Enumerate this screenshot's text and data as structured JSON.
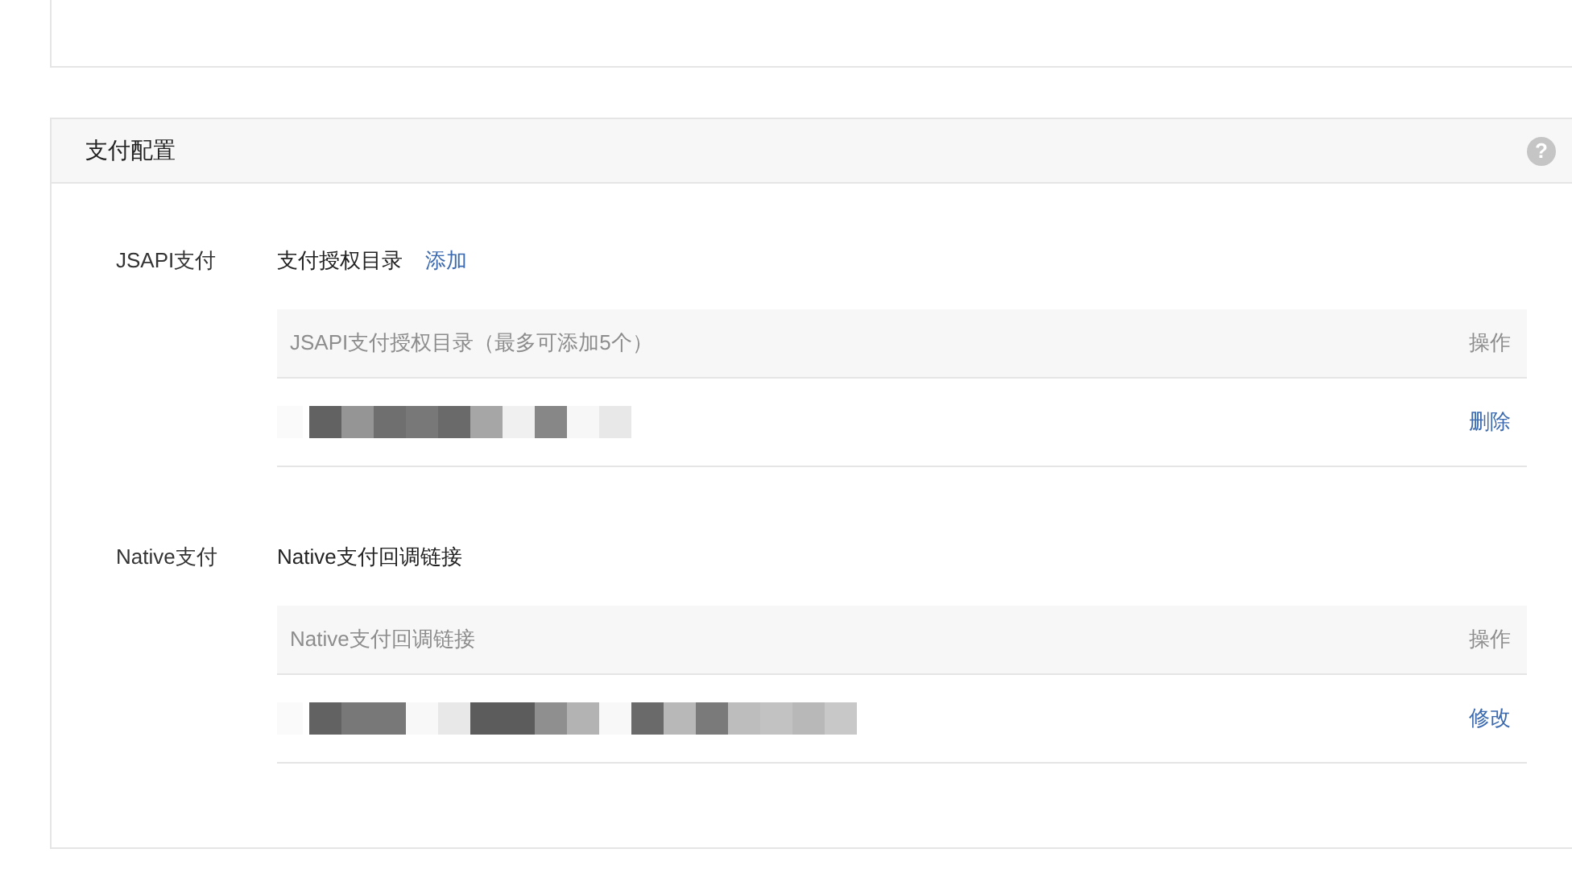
{
  "section": {
    "title": "支付配置",
    "help": "?"
  },
  "rows": [
    {
      "label": "JSAPI支付",
      "subtitle": "支付授权目录",
      "action": "添加",
      "table": {
        "columns": [
          "JSAPI支付授权目录（最多可添加5个）",
          "操作"
        ],
        "rows": [
          {
            "op": "删除",
            "kind": "short"
          }
        ]
      }
    },
    {
      "label": "Native支付",
      "subtitle": "Native支付回调链接",
      "table": {
        "columns": [
          "Native支付回调链接",
          "操作"
        ],
        "rows": [
          {
            "op": "修改",
            "kind": "long"
          }
        ]
      }
    }
  ]
}
